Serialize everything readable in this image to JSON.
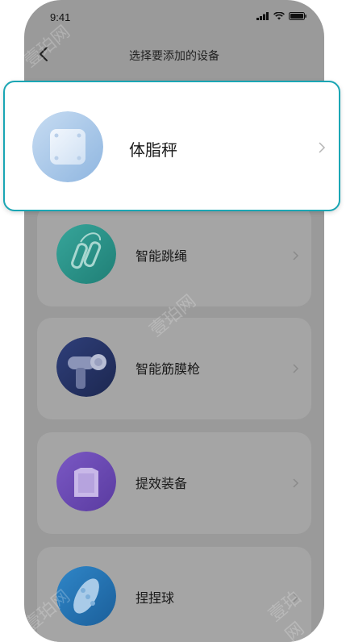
{
  "status_bar": {
    "time": "9:41"
  },
  "nav": {
    "title": "选择要添加的设备"
  },
  "highlighted_item": {
    "label": "体脂秤"
  },
  "items": [
    {
      "label": "智能跳绳"
    },
    {
      "label": "智能筋膜枪"
    },
    {
      "label": "提效装备"
    },
    {
      "label": "捏捏球"
    }
  ],
  "watermark": "壹珀网",
  "colors": {
    "highlight_border": "#1aa6b4",
    "overlay_gray": "#9a9a9a",
    "card_gray": "#a5a5a5"
  },
  "icons": {
    "back": "chevron-left-icon",
    "row_chevron": "chevron-right-icon",
    "scale": "body-fat-scale-icon",
    "rope": "jump-rope-icon",
    "gun": "massage-gun-icon",
    "gear": "efficiency-gear-icon",
    "ball": "squeeze-ball-icon"
  }
}
